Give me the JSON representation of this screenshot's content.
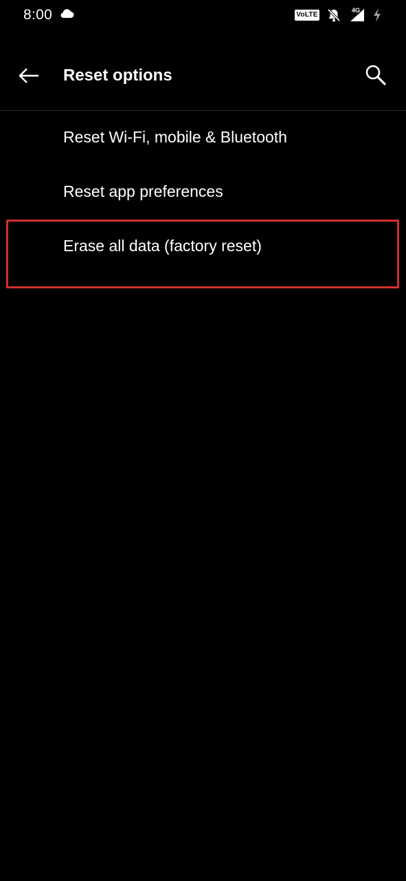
{
  "status_bar": {
    "time": "8:00",
    "volte_label": "VoLTE",
    "network_type": "4G",
    "icons": [
      "cloud-icon",
      "volte-badge",
      "bell-off-icon",
      "signal-icon",
      "charging-bolt-icon"
    ]
  },
  "app_bar": {
    "title": "Reset options",
    "back_icon": "back-arrow-icon",
    "search_icon": "search-icon"
  },
  "menu": {
    "items": [
      {
        "label": "Reset Wi-Fi, mobile & Bluetooth"
      },
      {
        "label": "Reset app preferences"
      },
      {
        "label": "Erase all data (factory reset)"
      }
    ]
  },
  "colors": {
    "background": "#000000",
    "text": "#ffffff",
    "divider": "#262626",
    "highlight": "#d32f2f"
  }
}
